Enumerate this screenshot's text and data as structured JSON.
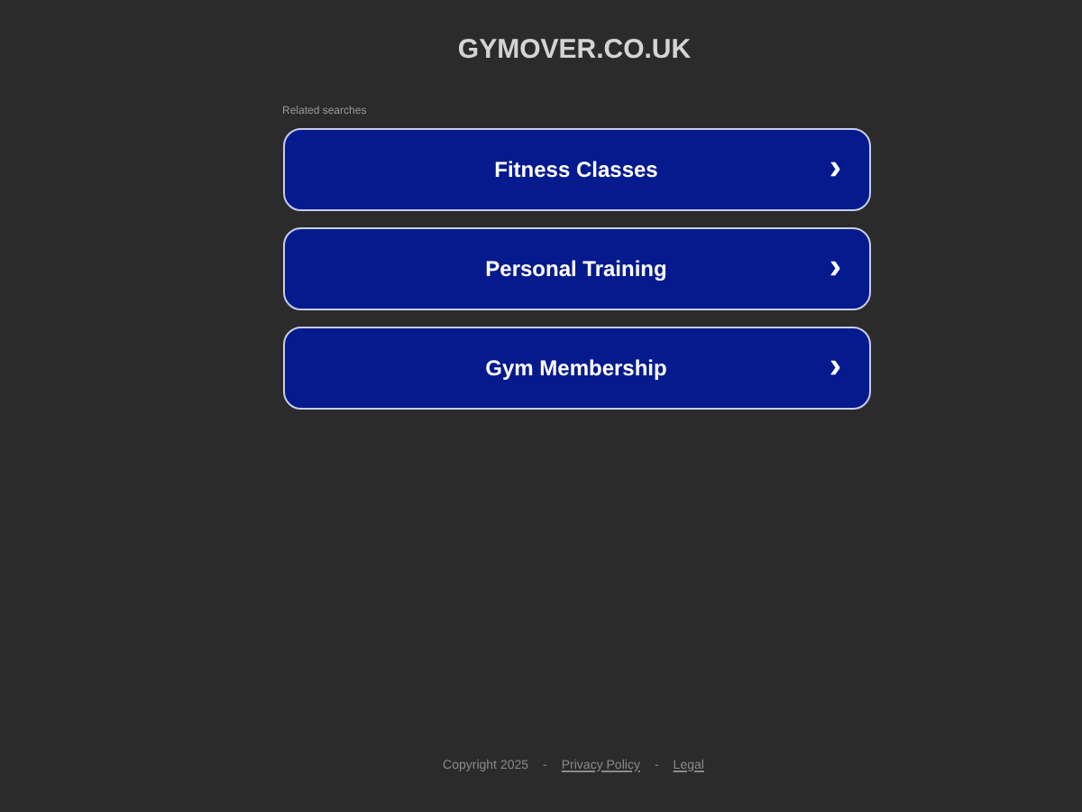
{
  "site_title": "GYMOVER.CO.UK",
  "related_label": "Related searches",
  "links": [
    {
      "label": "Fitness Classes",
      "arrow": "›"
    },
    {
      "label": "Personal Training",
      "arrow": "›"
    },
    {
      "label": "Gym Membership",
      "arrow": "›"
    }
  ],
  "footer": [
    {
      "kind": "text",
      "text": "Copyright 2025"
    },
    {
      "kind": "sep",
      "text": "-"
    },
    {
      "kind": "link",
      "text": "Privacy Policy"
    },
    {
      "kind": "sep",
      "text": "-"
    },
    {
      "kind": "link",
      "text": "Legal"
    }
  ]
}
